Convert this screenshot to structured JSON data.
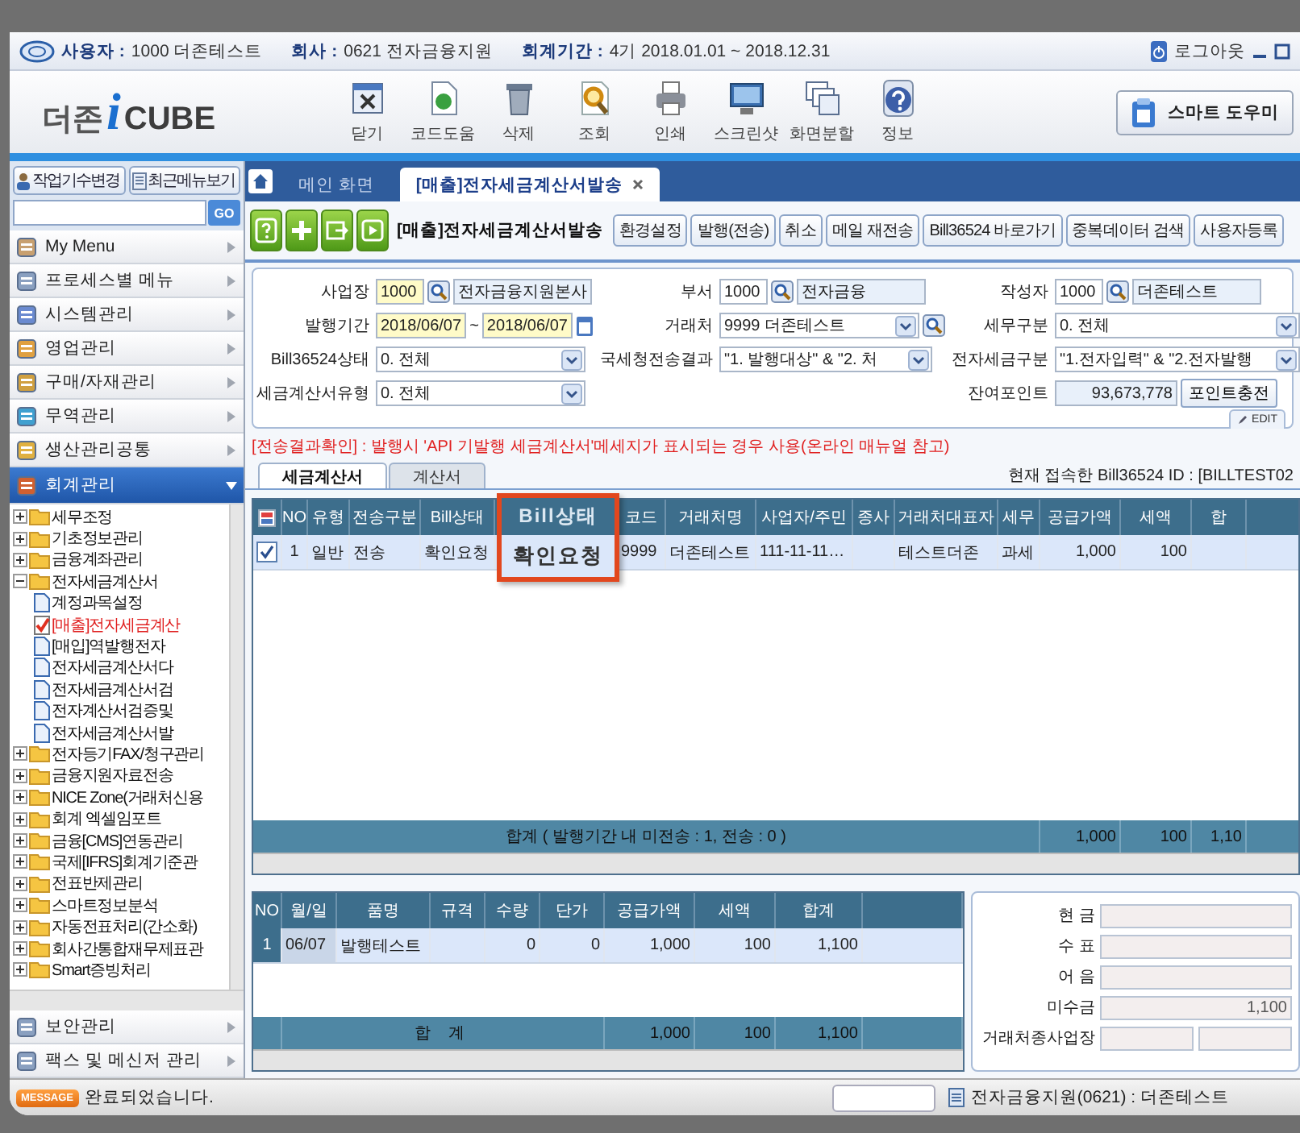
{
  "header": {
    "user_label": "사용자 :",
    "user": "1000 더존테스트",
    "company_label": "회사 :",
    "company": "0621 전자금융지원",
    "period_label": "회계기간 :",
    "period": "4기 2018.01.01 ~ 2018.12.31",
    "logout": "로그아웃"
  },
  "logo": {
    "brand": "더존",
    "mark": "i",
    "product": "CUBE"
  },
  "toolbar": [
    {
      "kind": "close",
      "label": "닫기"
    },
    {
      "kind": "code",
      "label": "코드도움"
    },
    {
      "kind": "delete",
      "label": "삭제"
    },
    {
      "kind": "search",
      "label": "조회"
    },
    {
      "kind": "print",
      "label": "인쇄"
    },
    {
      "kind": "screenshot",
      "label": "스크린샷"
    },
    {
      "kind": "split",
      "label": "화면분할"
    },
    {
      "kind": "info",
      "label": "정보"
    }
  ],
  "smart_button": "스마트 도우미",
  "sidebar": {
    "buttons": [
      "작업기수변경",
      "최근메뉴보기"
    ],
    "go": "GO",
    "menus": [
      {
        "label": "My Menu",
        "expanded": false
      },
      {
        "label": "프로세스별 메뉴",
        "expanded": false
      },
      {
        "label": "시스템관리",
        "expanded": false
      },
      {
        "label": "영업관리",
        "expanded": false
      },
      {
        "label": "구매/자재관리",
        "expanded": false
      },
      {
        "label": "무역관리",
        "expanded": false
      },
      {
        "label": "생산관리공통",
        "expanded": false
      },
      {
        "label": "회계관리",
        "expanded": true,
        "children": [
          {
            "kind": "folder",
            "label": "세무조정",
            "expanded": false
          },
          {
            "kind": "folder",
            "label": "기초정보관리",
            "expanded": false
          },
          {
            "kind": "folder",
            "label": "금융계좌관리",
            "expanded": false
          },
          {
            "kind": "folder",
            "label": "전자세금계산서",
            "expanded": true,
            "children": [
              {
                "kind": "page",
                "label": "계정과목설정",
                "selected": false
              },
              {
                "kind": "page",
                "label": "[매출]전자세금계산",
                "selected": true
              },
              {
                "kind": "page",
                "label": "[매입]역발행전자",
                "selected": false
              },
              {
                "kind": "page",
                "label": "전자세금계산서다",
                "selected": false
              },
              {
                "kind": "page",
                "label": "전자세금계산서검",
                "selected": false
              },
              {
                "kind": "page",
                "label": "전자계산서검증및",
                "selected": false
              },
              {
                "kind": "page",
                "label": "전자세금계산서발",
                "selected": false
              }
            ]
          },
          {
            "kind": "folder",
            "label": "전자등기FAX/청구관리",
            "expanded": false
          },
          {
            "kind": "folder",
            "label": "금융지원자료전송",
            "expanded": false
          },
          {
            "kind": "folder",
            "label": "NICE Zone(거래처신용",
            "expanded": false
          },
          {
            "kind": "folder",
            "label": "회계 엑셀임포트",
            "expanded": false
          },
          {
            "kind": "folder",
            "label": "금융[CMS]연동관리",
            "expanded": false
          },
          {
            "kind": "folder",
            "label": "국제[IFRS]회계기준관",
            "expanded": false
          },
          {
            "kind": "folder",
            "label": "전표반제관리",
            "expanded": false
          },
          {
            "kind": "folder",
            "label": "스마트정보분석",
            "expanded": false
          },
          {
            "kind": "folder",
            "label": "자동전표처리(간소화)",
            "expanded": false
          },
          {
            "kind": "folder",
            "label": "회사간통합재무제표관",
            "expanded": false
          },
          {
            "kind": "folder",
            "label": "Smart증빙처리",
            "expanded": false
          }
        ]
      },
      {
        "label": "보안관리",
        "expanded": false
      },
      {
        "label": "팩스 및 메신저 관리",
        "expanded": false
      }
    ]
  },
  "tabs": [
    {
      "label": "메인 화면",
      "selected": false,
      "closable": false
    },
    {
      "label": "[매출]전자세금계산서발송",
      "selected": true,
      "closable": true
    }
  ],
  "quick_buttons": [
    {
      "kind": "help"
    },
    {
      "kind": "add"
    },
    {
      "kind": "refresh"
    },
    {
      "kind": "run"
    }
  ],
  "page_title": "[매출]전자세금계산서발송",
  "actions": [
    "환경설정",
    "발행(전송)",
    "취소",
    "메일 재전송",
    "Bill36524 바로가기",
    "중복데이터 검색",
    "사용자등록"
  ],
  "form": {
    "columns": [
      [
        {
          "kind": "code",
          "label": "사업장",
          "code": "1000",
          "name": "전자금융지원본사",
          "required": true
        },
        {
          "kind": "date_range",
          "label": "발행기간",
          "from": "2018/06/07",
          "separator": "~",
          "to": "2018/06/07",
          "required": true
        },
        {
          "kind": "select",
          "label": "Bill36524상태",
          "value": "0. 전체"
        },
        {
          "kind": "select",
          "label": "세금계산서유형",
          "value": "0. 전체"
        }
      ],
      [
        {
          "kind": "code",
          "label": "부서",
          "code": "1000",
          "name": "전자금융",
          "required": false
        },
        {
          "kind": "select_search",
          "label": "거래처",
          "value": "9999 더존테스트"
        },
        {
          "kind": "select",
          "label": "국세청전송결과",
          "value": "\"1. 발행대상\" & \"2. 처"
        }
      ],
      [
        {
          "kind": "code",
          "label": "작성자",
          "code": "1000",
          "name": "더존테스트",
          "required": false
        },
        {
          "kind": "select",
          "label": "세무구분",
          "value": "0. 전체"
        },
        {
          "kind": "select",
          "label": "전자세금구분",
          "value": "\"1.전자입력\" & \"2.전자발행"
        },
        {
          "kind": "points",
          "label": "잔여포인트",
          "value": "93,673,778",
          "button": "포인트충전"
        }
      ]
    ],
    "edit_tab": "EDIT"
  },
  "notice": "[전송결과확인] : 발행시 'API 기발행 세금계산서'메세지가 표시되는 경우 사용(온라인 매뉴얼 참고)",
  "account_info": "현재 접속한 Bill36524 ID : [BILLTEST02",
  "sub_tabs": [
    {
      "label": "세금계산서",
      "selected": true
    },
    {
      "label": "계산서",
      "selected": false
    }
  ],
  "grid": {
    "columns": [
      "NO",
      "유형",
      "전송구분",
      "Bill상태",
      "코드",
      "거래처명",
      "사업자/주민",
      "종사",
      "거래처대표자",
      "세무",
      "공급가액",
      "세액",
      "합"
    ],
    "rows": [
      {
        "checked": true,
        "selected": true,
        "cells": {
          "no": "1",
          "type": "일반",
          "transmission": "전송",
          "bill_status": "확인요청",
          "code": "9999",
          "client": "더존테스트",
          "reg_no": "111-11-11…",
          "representative": "테스트더존",
          "taxation": "과세",
          "supply": "1,000",
          "tax": "100"
        }
      }
    ],
    "total": {
      "label": "합계 ( 발행기간 내 미전송 : 1, 전송 : 0 )",
      "supply": "1,000",
      "tax": "100",
      "total": "1,10"
    }
  },
  "callout": {
    "header": "Bill상태",
    "value": "확인요청"
  },
  "detail_grid": {
    "columns": [
      "NO",
      "월/일",
      "품명",
      "규격",
      "수량",
      "단가",
      "공급가액",
      "세액",
      "합계"
    ],
    "rows": [
      {
        "selected": true,
        "cells": {
          "no": "1",
          "date": "06/07",
          "item": "발행테스트",
          "qty": "0",
          "price": "0",
          "supply": "1,000",
          "tax": "100",
          "total": "1,100"
        }
      }
    ],
    "total": {
      "label": "합 계",
      "supply": "1,000",
      "tax": "100",
      "total": "1,100"
    }
  },
  "payment": [
    {
      "kind": "single",
      "label": "현 금"
    },
    {
      "kind": "single",
      "label": "수 표"
    },
    {
      "kind": "single",
      "label": "어 음"
    },
    {
      "kind": "single",
      "label": "미수금",
      "value": "1,100"
    },
    {
      "kind": "double",
      "label": "거래처종사업장"
    }
  ],
  "status_bar": {
    "badge": "MESSAGE",
    "message": "완료되었습니다.",
    "connection": "전자금융지원(0621) : 더존테스트"
  }
}
